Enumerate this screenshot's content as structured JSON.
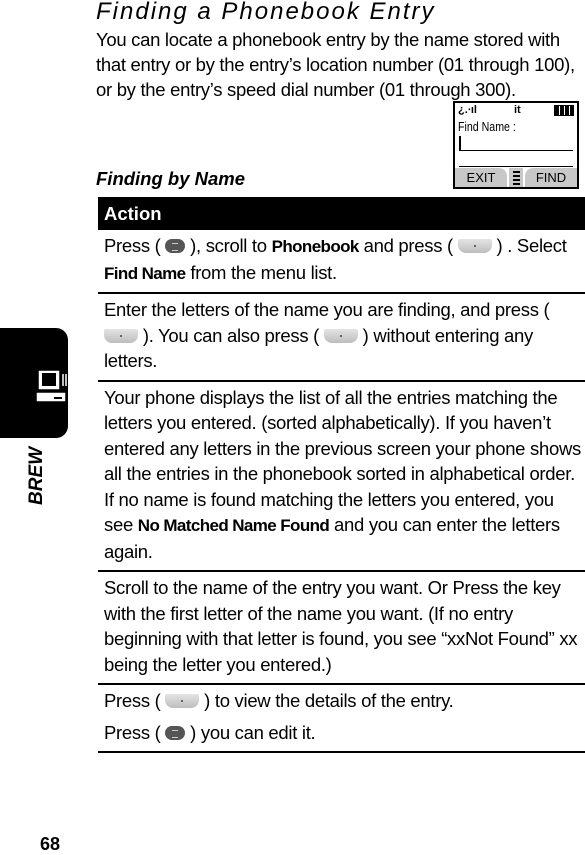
{
  "title": "Finding a Phonebook Entry",
  "intro": "You can locate a phonebook entry by the name stored with that entry or by the entry’s location number (01 through 100), or by the entry’s speed dial number (01 through 300).",
  "subhead": "Finding by Name",
  "phone_screen": {
    "status_left": "¿.∙ıl",
    "status_mid": "it",
    "prompt": "Find Name :",
    "left_soft": "EXIT",
    "right_soft": "FIND"
  },
  "table": {
    "header": "Action",
    "rows": [
      [
        [
          {
            "t": "Press ( "
          },
          {
            "icon": "menu-key"
          },
          {
            "t": " ), scroll to "
          },
          {
            "b": "Phonebook"
          },
          {
            "t": " and press ( "
          },
          {
            "icon": "soft-key"
          },
          {
            "t": " ) . Select "
          },
          {
            "b": "Find Name"
          },
          {
            "t": " from the menu list."
          }
        ]
      ],
      [
        [
          {
            "t": "Enter the letters of the name you are finding, and press ( "
          },
          {
            "icon": "soft-key"
          },
          {
            "t": " ). You can also press ( "
          },
          {
            "icon": "soft-key"
          },
          {
            "t": " ) without entering any letters."
          }
        ]
      ],
      [
        [
          {
            "t": "Your phone displays the list of all the entries matching the letters you entered. (sorted alphabetically). If you haven’t entered any letters in the previous screen your phone shows all the entries in the phonebook sorted in alphabetical order. If no name is found matching the letters you entered, you see "
          },
          {
            "b": "No Matched Name Found"
          },
          {
            "t": " and you can enter the letters again."
          }
        ]
      ],
      [
        [
          {
            "t": "Scroll to the name of the entry you want. Or Press the key with the first letter of the name you want. (If no entry beginning with that letter is found, you see “xxNot Found” xx being the letter you entered.)"
          }
        ]
      ],
      [
        [
          {
            "t": "Press ( "
          },
          {
            "icon": "soft-key"
          },
          {
            "t": " ) to view the details of the entry."
          }
        ],
        [
          {
            "t": "Press ( "
          },
          {
            "icon": "menu-key"
          },
          {
            "t": " ) you can edit it."
          }
        ]
      ]
    ]
  },
  "side_tab": "BREW",
  "page_number": "68"
}
